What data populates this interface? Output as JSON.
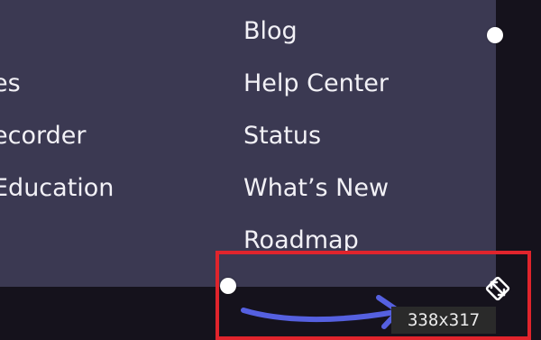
{
  "menu": {
    "left_column": [
      {
        "label": "es"
      },
      {
        "label": "ecorder"
      },
      {
        "label": " Education"
      }
    ],
    "right_column": [
      {
        "label": "Blog"
      },
      {
        "label": "Help Center"
      },
      {
        "label": "Status"
      },
      {
        "label": "What’s New"
      },
      {
        "label": "Roadmap"
      }
    ]
  },
  "selection": {
    "size_readout": "338x317",
    "highlight_color": "#e0242c"
  },
  "annotation": {
    "arrow_color": "#5560e0"
  },
  "icons": {
    "resize": "resize-diagonal-icon",
    "handle": "drag-handle"
  },
  "colors": {
    "panel": "#3b3952",
    "background": "#15121c",
    "text": "#f2f1f6"
  }
}
